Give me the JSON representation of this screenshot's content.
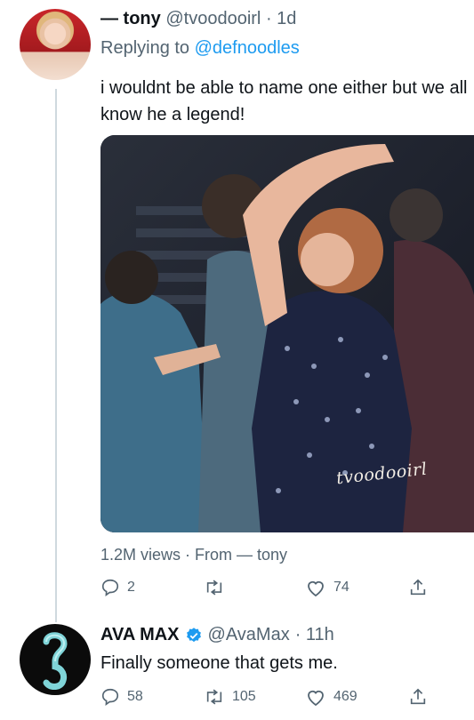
{
  "tweet1": {
    "display_name": "— tony",
    "handle": "@tvoodooirl",
    "time": "· 1d",
    "replying_prefix": "Replying to ",
    "replying_handle": "@defnoodles",
    "text": "i wouldnt be able to name one either but we all know he a legend!",
    "media_watermark": "tvoodooirl",
    "views": "1.2M views · From — tony",
    "actions": {
      "reply_count": "2",
      "retweet_count": "",
      "like_count": "74"
    }
  },
  "tweet2": {
    "display_name": "AVA MAX",
    "handle": "@AvaMax",
    "time": "· 11h",
    "text": "Finally someone that gets me.",
    "actions": {
      "reply_count": "58",
      "retweet_count": "105",
      "like_count": "469"
    }
  },
  "colors": {
    "link": "#1d9bf0",
    "muted": "#536471",
    "verified": "#1d9bf0",
    "thread_line": "#cfd9de"
  }
}
